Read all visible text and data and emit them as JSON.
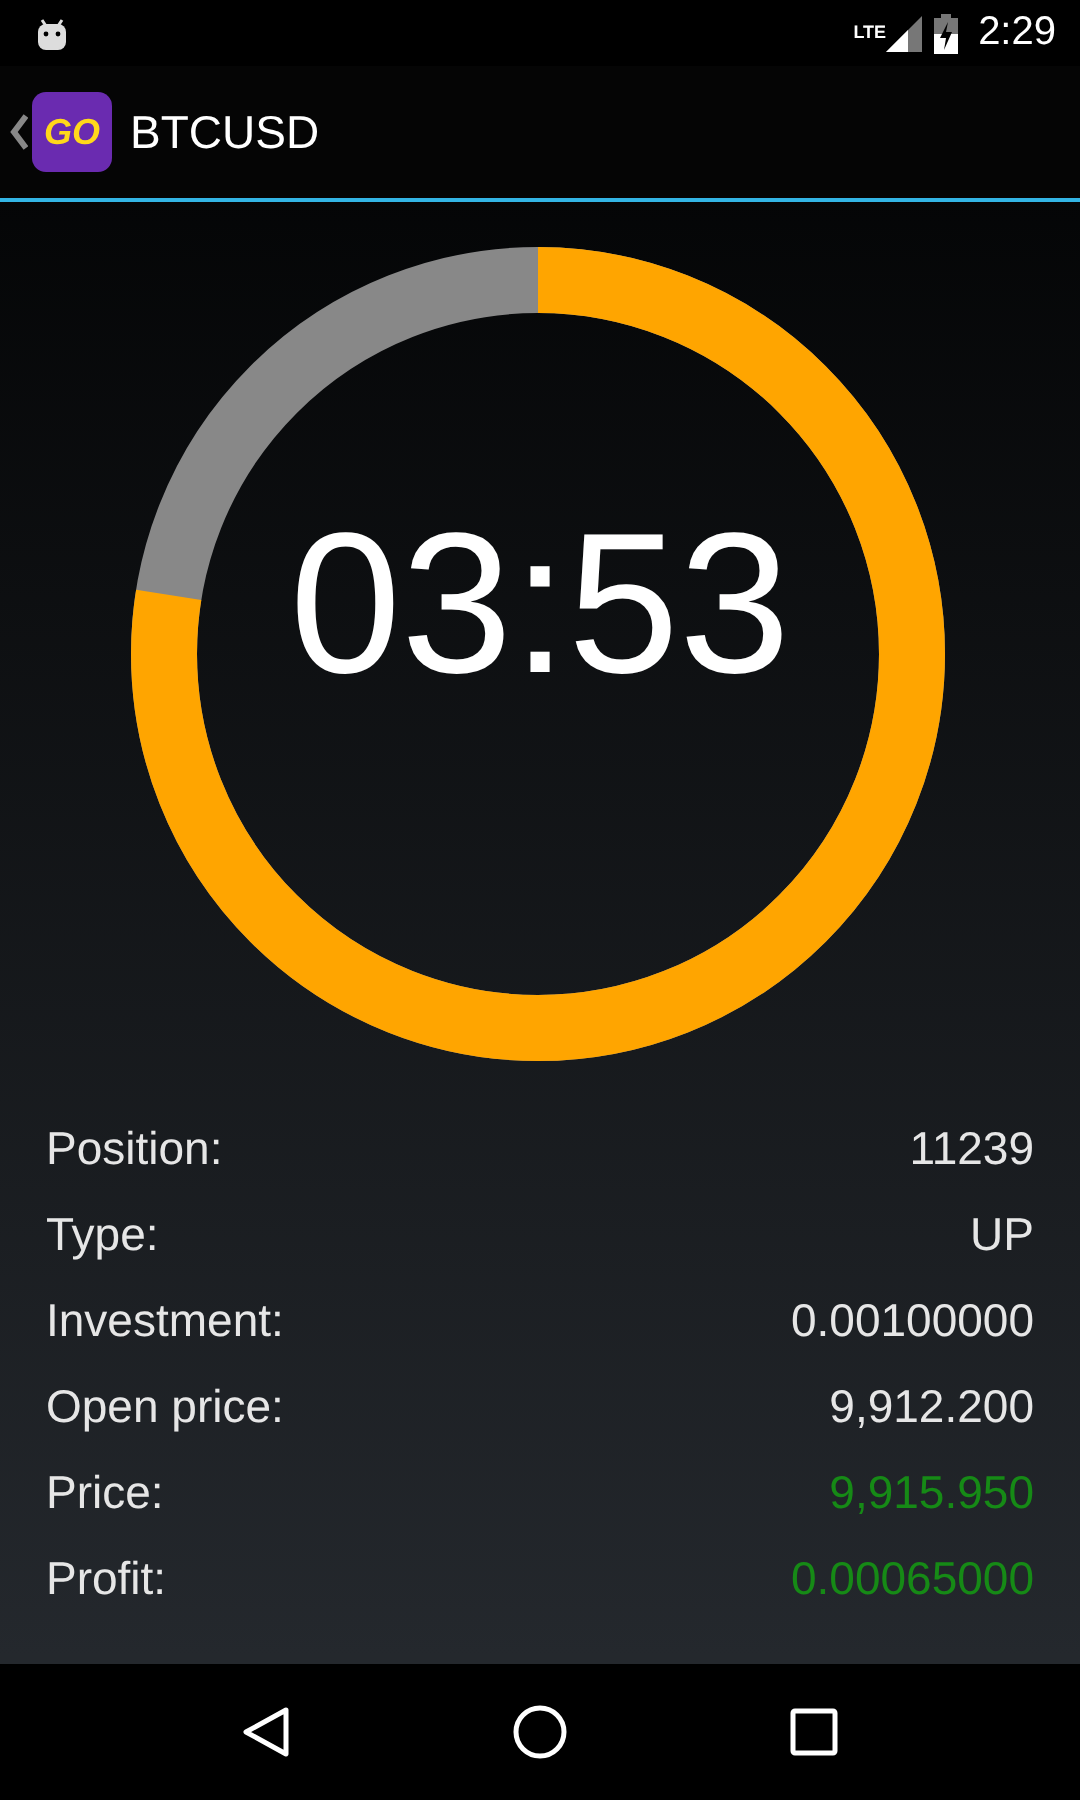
{
  "status_bar": {
    "network": "LTE",
    "time": "2:29"
  },
  "app_bar": {
    "logo_text": "GO",
    "title": "BTCUSD"
  },
  "timer": {
    "time": "03:53"
  },
  "details": [
    {
      "label": "Position:",
      "value": "11239",
      "color": "#e6e6e6"
    },
    {
      "label": "Type:",
      "value": "UP",
      "color": "#e6e6e6"
    },
    {
      "label": "Investment:",
      "value": "0.00100000",
      "color": "#e6e6e6"
    },
    {
      "label": "Open price:",
      "value": "9,912.200",
      "color": "#e6e6e6"
    },
    {
      "label": "Price:",
      "value": "9,915.950",
      "color": "#168a16"
    },
    {
      "label": "Profit:",
      "value": "0.00065000",
      "color": "#168a16"
    }
  ]
}
